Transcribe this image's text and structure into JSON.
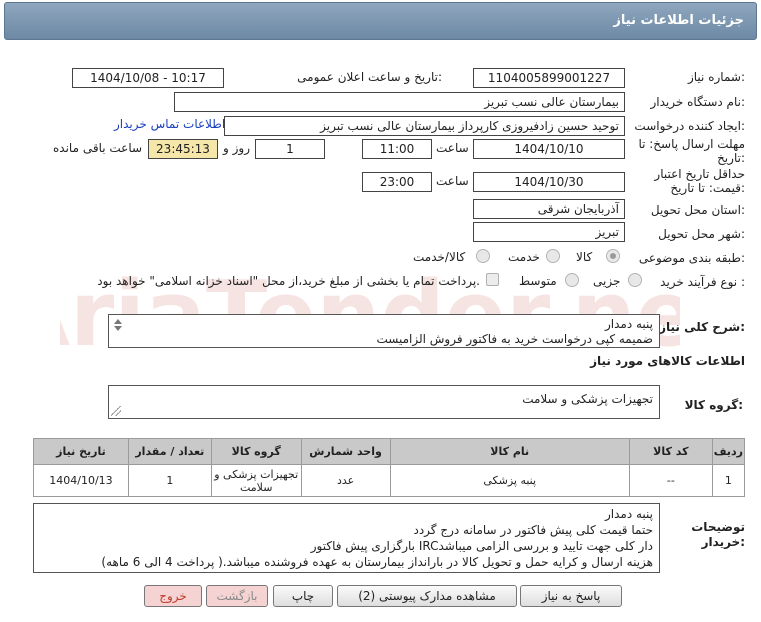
{
  "page": {
    "title": "جزئیات اطلاعات نیاز",
    "need_number_label": "شماره نیاز:",
    "need_number": "1104005899001227",
    "announce_label": "تاریخ و ساعت اعلان عمومی:",
    "announce_value": "1404/10/08 - 10:17",
    "buyer_org_label": "نام دستگاه خریدار:",
    "buyer_org": "بیمارستان عالی نسب تبریز",
    "creator_label": "ایجاد کننده درخواست:",
    "creator": "توحید حسین زادفیروزی کارپرداز بیمارستان عالی نسب تبریز",
    "contact_link": "اطلاعات تماس خریدار",
    "reply_deadline_label": "مهلت ارسال پاسخ: تا تاریخ:",
    "reply_date": "1404/10/10",
    "time_label": "ساعت",
    "reply_time": "11:00",
    "days_value": "1",
    "days_label": "روز و",
    "remaining_time": "23:45:13",
    "remaining_label": "ساعت باقی مانده",
    "validity_label": "حداقل تاریخ اعتبار قیمت: تا تاریخ:",
    "validity_date": "1404/10/30",
    "validity_time_label": "ساعت",
    "validity_time": "23:00",
    "province_label": "استان محل تحویل:",
    "province": "آذربایجان شرقی",
    "city_label": "شهر محل تحویل:",
    "city": "تبریز",
    "category_label": "طبقه بندی موضوعی:",
    "category_options": [
      "کالا",
      "خدمت",
      "کالا/خدمت"
    ],
    "category_selected": "کالا",
    "process_label": "نوع فرآیند خرید :",
    "process_options": [
      "جزیی",
      "متوسط"
    ],
    "payment_note": "پرداخت تمام یا بخشی از مبلغ خرید،از محل \"اسناد خزانه اسلامی\" خواهد بود.",
    "general_desc_label": "شرح کلی نیاز:",
    "general_desc_line1": "پنبه دمدار",
    "general_desc_line2": "ضمیمه کپی درخواست خرید به فاکتور فروش الزامیست",
    "goods_info_title": "اطلاعات کالاهای مورد نیاز",
    "goods_group_label": "گروه کالا:",
    "goods_group": "تجهیزات پزشکی و سلامت",
    "buyer_notes_label": "توضیحات خریدار:",
    "buyer_notes": [
      "پنبه دمدار",
      "حتما قیمت کلی پیش فاکتور در سامانه درج گردد",
      "بارگزاری پیش فاکتور IRCدار کلی جهت تایید و بررسی الزامی میباشد",
      "هزینه ارسال و کرایه حمل و تحویل کالا در بارانداز بیمارستان به عهده فروشنده میباشد.( پرداخت 4 الی 6 ماهه)"
    ],
    "watermark": "AriaTender.net"
  },
  "table": {
    "headers": [
      "ردیف",
      "کد کالا",
      "نام کالا",
      "واحد شمارش",
      "گروه کالا",
      "تعداد / مقدار",
      "تاریخ نیاز"
    ],
    "rows": [
      [
        "1",
        "--",
        "پنبه پزشکی",
        "عدد",
        "تجهیزات پزشکی و سلامت",
        "1",
        "1404/10/13"
      ]
    ]
  },
  "buttons": {
    "reply": "پاسخ به نیاز",
    "docs": "مشاهده مدارک پیوستی (2)",
    "print": "چاپ",
    "back": "بازگشت",
    "exit": "خروج"
  },
  "colors": {
    "titlebar": "#7d97b2",
    "time_bg": "#f5e6a9",
    "table_header": "#c9c9c9",
    "link": "#1a3fbf",
    "back_exit_bg": "#f5d3d3",
    "back_text": "#8a8a8a",
    "exit_text": "#c0392b"
  }
}
